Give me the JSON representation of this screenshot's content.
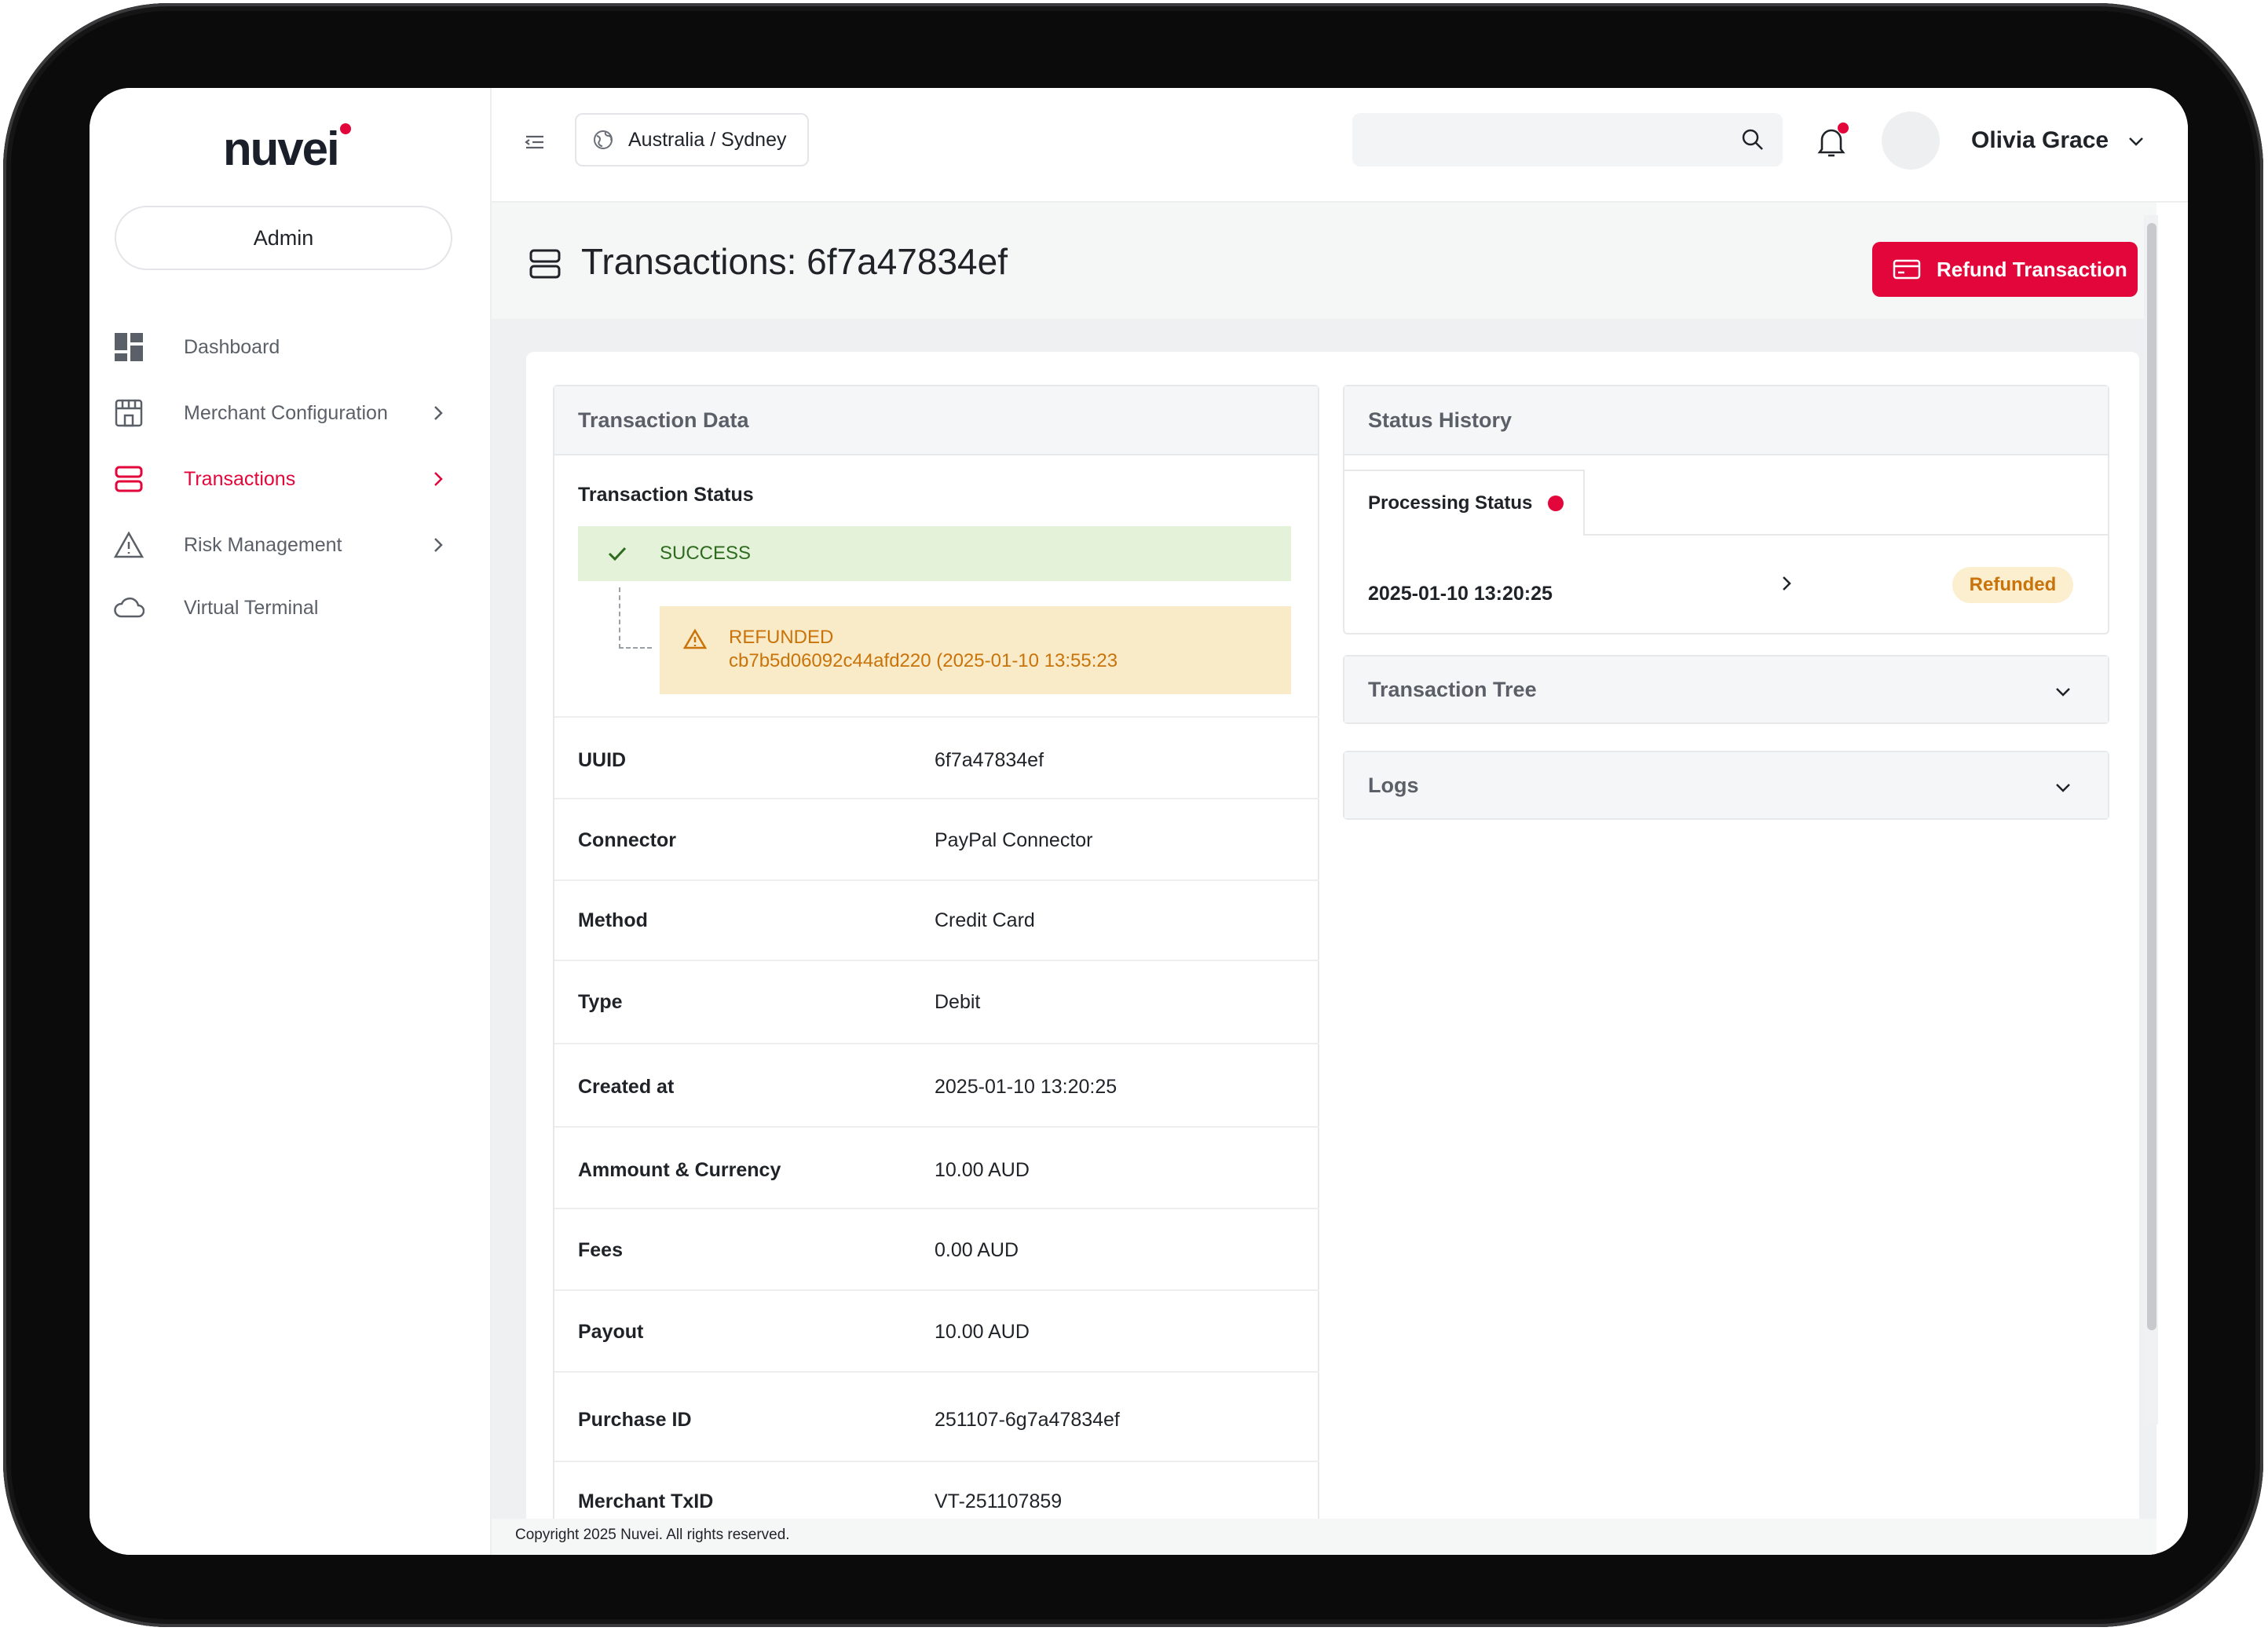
{
  "brand": {
    "logo_text": "nuvei",
    "accent": "#e3063a"
  },
  "sidebar": {
    "role": "Admin",
    "items": [
      {
        "label": "Dashboard",
        "icon": "dashboard-icon",
        "has_chevron": false,
        "active": false
      },
      {
        "label": "Merchant Configuration",
        "icon": "store-icon",
        "has_chevron": true,
        "active": false
      },
      {
        "label": "Transactions",
        "icon": "transactions-icon",
        "has_chevron": true,
        "active": true
      },
      {
        "label": "Risk Management",
        "icon": "warning-icon",
        "has_chevron": true,
        "active": false
      },
      {
        "label": "Virtual Terminal",
        "icon": "cloud-icon",
        "has_chevron": false,
        "active": false
      }
    ]
  },
  "topbar": {
    "timezone": "Australia / Sydney",
    "search_placeholder": "",
    "user_name": "Olivia Grace"
  },
  "page": {
    "title": "Transactions: 6f7a47834ef",
    "refund_button": "Refund Transaction"
  },
  "transaction_data": {
    "panel_title": "Transaction Data",
    "status_label": "Transaction Status",
    "status_success": "SUCCESS",
    "refunded_label": "REFUNDED",
    "refunded_detail": "cb7b5d06092c44afd220 (2025-01-10 13:55:23",
    "rows": [
      {
        "key": "UUID",
        "value": "6f7a47834ef"
      },
      {
        "key": "Connector",
        "value": "PayPal Connector"
      },
      {
        "key": "Method",
        "value": "Credit Card"
      },
      {
        "key": "Type",
        "value": "Debit"
      },
      {
        "key": "Created at",
        "value": "2025-01-10 13:20:25"
      },
      {
        "key": "Ammount & Currency",
        "value": "10.00 AUD"
      },
      {
        "key": "Fees",
        "value": "0.00 AUD"
      },
      {
        "key": "Payout",
        "value": "10.00 AUD"
      },
      {
        "key": "Purchase ID",
        "value": "251107-6g7a47834ef"
      },
      {
        "key": "Merchant TxID",
        "value": "VT-251107859"
      }
    ]
  },
  "status_history": {
    "panel_title": "Status History",
    "tab_label": "Processing Status",
    "entry_time": "2025-01-10 13:20:25",
    "entry_badge": "Refunded"
  },
  "accordions": {
    "tree": "Transaction Tree",
    "logs": "Logs"
  },
  "footer": {
    "copyright": "Copyright 2025 Nuvei. All rights reserved."
  }
}
